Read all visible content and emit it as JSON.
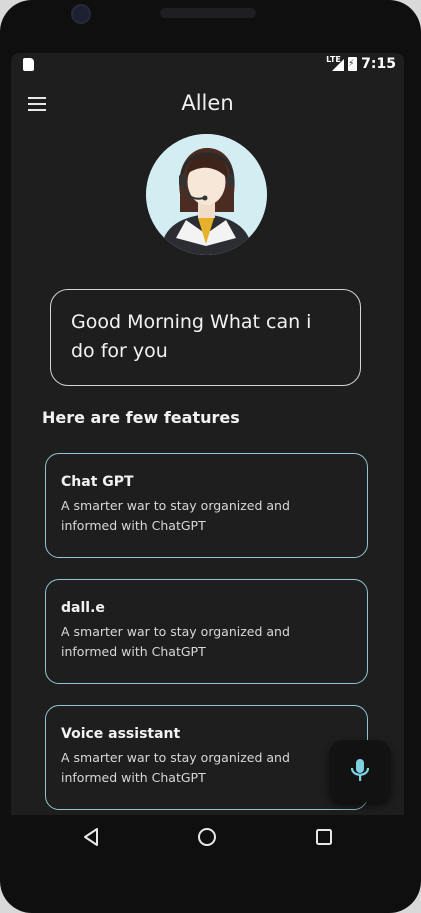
{
  "status_bar": {
    "network": "LTE",
    "time": "7:15"
  },
  "app_bar": {
    "title": "Allen"
  },
  "avatar": {
    "icon": "assistant-avatar"
  },
  "greeting": {
    "text": "Good Morning What can i do for you"
  },
  "features": {
    "heading": "Here are few features",
    "items": [
      {
        "title": "Chat GPT",
        "description": "A smarter war to stay organized and informed with ChatGPT"
      },
      {
        "title": "dall.e",
        "description": "A smarter war to stay organized and informed with ChatGPT"
      },
      {
        "title": "Voice assistant",
        "description": "A smarter war to stay organized and informed with ChatGPT"
      }
    ]
  },
  "fab": {
    "icon": "mic-icon"
  },
  "colors": {
    "background": "#1e1e1f",
    "card_border": "#8fc6d2",
    "mic_accent": "#7fd0e0"
  }
}
